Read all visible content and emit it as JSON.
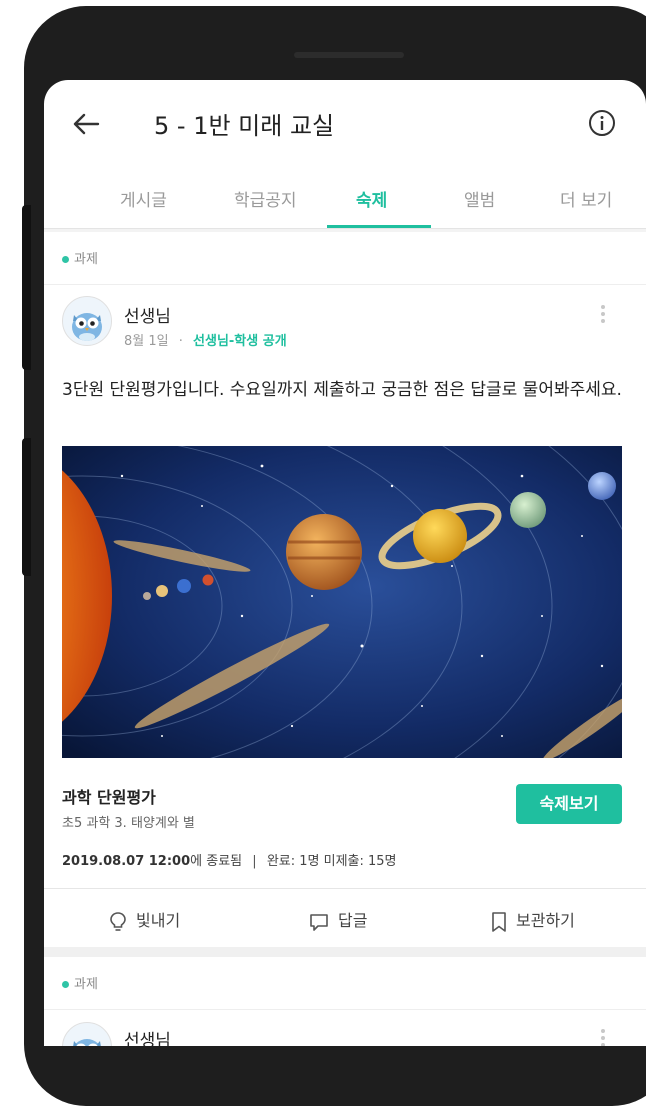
{
  "header": {
    "title": "5 - 1반 미래 교실",
    "back_icon": "arrow-left-icon",
    "info_icon": "info-circle-icon"
  },
  "tabs": [
    {
      "label": "게시글",
      "active": false
    },
    {
      "label": "학급공지",
      "active": false
    },
    {
      "label": "숙제",
      "active": true
    },
    {
      "label": "앨범",
      "active": false
    },
    {
      "label": "더 보기",
      "active": false
    }
  ],
  "accent_color": "#1fbf9f",
  "posts": [
    {
      "section_label": "과제",
      "author": "선생님",
      "date": "8월 1일",
      "visibility": "선생님-학생 공개",
      "body": "3단원 단원평가입니다. 수요일까지 제출하고 궁금한 점은 답글로 물어봐주세요.",
      "image_icon": "solar-system-image",
      "homework": {
        "title": "과학 단원평가",
        "subtitle": "초5 과학 3. 태양계와 별",
        "button_label": "숙제보기",
        "deadline": "2019.08.07 12:00",
        "deadline_suffix": "에 종료됨",
        "separator": "|",
        "status": "완료: 1명 미제출: 15명"
      },
      "actions": [
        {
          "label": "빛내기",
          "icon": "lightbulb-icon"
        },
        {
          "label": "답글",
          "icon": "comment-icon"
        },
        {
          "label": "보관하기",
          "icon": "bookmark-icon"
        }
      ]
    },
    {
      "section_label": "과제",
      "author": "선생님"
    }
  ]
}
